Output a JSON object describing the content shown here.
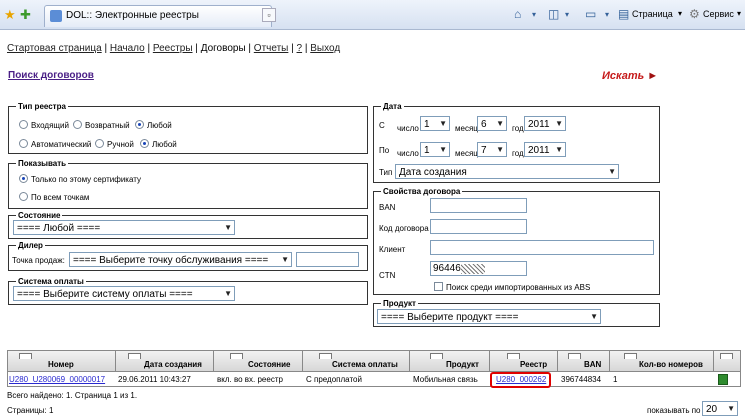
{
  "browser": {
    "tab_title": "DOL:: Электронные реестры",
    "page_menu": "Страница",
    "tools_menu": "Сервис"
  },
  "nav": {
    "items": [
      "Стартовая страница",
      "Начало",
      "Реестры",
      "Договоры",
      "Отчеты",
      "?",
      "Выход"
    ],
    "current": "Договоры"
  },
  "page": {
    "title": "Поиск договоров",
    "search_button": "Искать"
  },
  "registry_type": {
    "legend": "Тип реестра",
    "row1": [
      "Входящий",
      "Возвратный",
      "Любой"
    ],
    "row2": [
      "Автоматический",
      "Ручной",
      "Любой"
    ],
    "selected_row1": "Любой",
    "selected_row2": "Любой"
  },
  "show": {
    "legend": "Показывать",
    "options": [
      "Только по этому сертификату",
      "По всем точкам"
    ],
    "selected": "Только по этому сертификату"
  },
  "state": {
    "legend": "Состояние",
    "value": "==== Любой ===="
  },
  "dealer": {
    "legend": "Дилер",
    "point_label": "Точка продаж:",
    "value": "==== Выберите точку обслуживания ===="
  },
  "payment": {
    "legend": "Система оплаты",
    "value": "==== Выберите систему оплаты ===="
  },
  "date": {
    "legend": "Дата",
    "from_label": "С",
    "to_label": "По",
    "day_label": "число",
    "month_label": "месяц",
    "year_label": "год",
    "from": {
      "day": "1",
      "month": "6",
      "year": "2011"
    },
    "to": {
      "day": "1",
      "month": "7",
      "year": "2011"
    },
    "type_label": "Тип",
    "type_value": "Дата создания"
  },
  "contract_props": {
    "legend": "Свойства договора",
    "ban_label": "BAN",
    "code_label": "Код договора",
    "client_label": "Клиент",
    "ctn_label": "CTN",
    "ctn_value": "96446",
    "abs_check_label": "Поиск среди импортированных из ABS"
  },
  "product": {
    "legend": "Продукт",
    "value": "==== Выберите продукт ===="
  },
  "table": {
    "headers": [
      "Номер",
      "Дата создания",
      "Состояние",
      "Система оплаты",
      "Продукт",
      "Реестр",
      "BAN",
      "Кол-во номеров"
    ],
    "rows": [
      {
        "number": "U280_U280069_00000017",
        "created": "29.06.2011 10:43:27",
        "state": "вкл. во вх. реестр",
        "payment": "С предоплатой",
        "product": "Мобильная связь",
        "registry": "U280_000262",
        "ban": "396744834",
        "count": "1"
      }
    ]
  },
  "footer": {
    "found": "Всего найдено: 1. Страница 1 из 1.",
    "pages": "Страницы: 1",
    "show_per_label": "показывать по",
    "show_per_value": "20"
  },
  "colors": {
    "title": "#4a1f86",
    "search": "#c61b1b",
    "link": "#2a2ad0",
    "highlight": "#e00000"
  }
}
